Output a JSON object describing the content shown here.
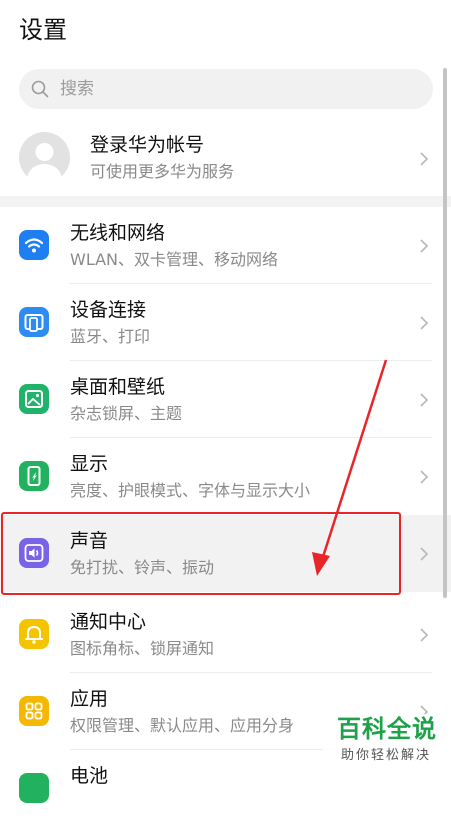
{
  "page": {
    "title": "设置"
  },
  "search": {
    "placeholder": "搜索"
  },
  "account": {
    "title": "登录华为帐号",
    "subtitle": "可使用更多华为服务"
  },
  "items": [
    {
      "label": "无线和网络",
      "desc": "WLAN、双卡管理、移动网络",
      "icon": "wifi-icon",
      "color": "#1e7ff2"
    },
    {
      "label": "设备连接",
      "desc": "蓝牙、打印",
      "icon": "device-connect-icon",
      "color": "#2d8cf0"
    },
    {
      "label": "桌面和壁纸",
      "desc": "杂志锁屏、主题",
      "icon": "wallpaper-icon",
      "color": "#20b36b"
    },
    {
      "label": "显示",
      "desc": "亮度、护眼模式、字体与显示大小",
      "icon": "display-icon",
      "color": "#22b25f"
    },
    {
      "label": "声音",
      "desc": "免打扰、铃声、振动",
      "icon": "sound-icon",
      "color": "#7b63e8"
    },
    {
      "label": "通知中心",
      "desc": "图标角标、锁屏通知",
      "icon": "bell-icon",
      "color": "#f5c400"
    },
    {
      "label": "应用",
      "desc": "权限管理、默认应用、应用分身",
      "icon": "apps-icon",
      "color": "#f5b800"
    },
    {
      "label": "电池",
      "desc": "",
      "icon": "battery-icon",
      "color": "#22b25f"
    }
  ],
  "watermark": {
    "brand": "百科全说",
    "slogan": "助你轻松解决"
  }
}
